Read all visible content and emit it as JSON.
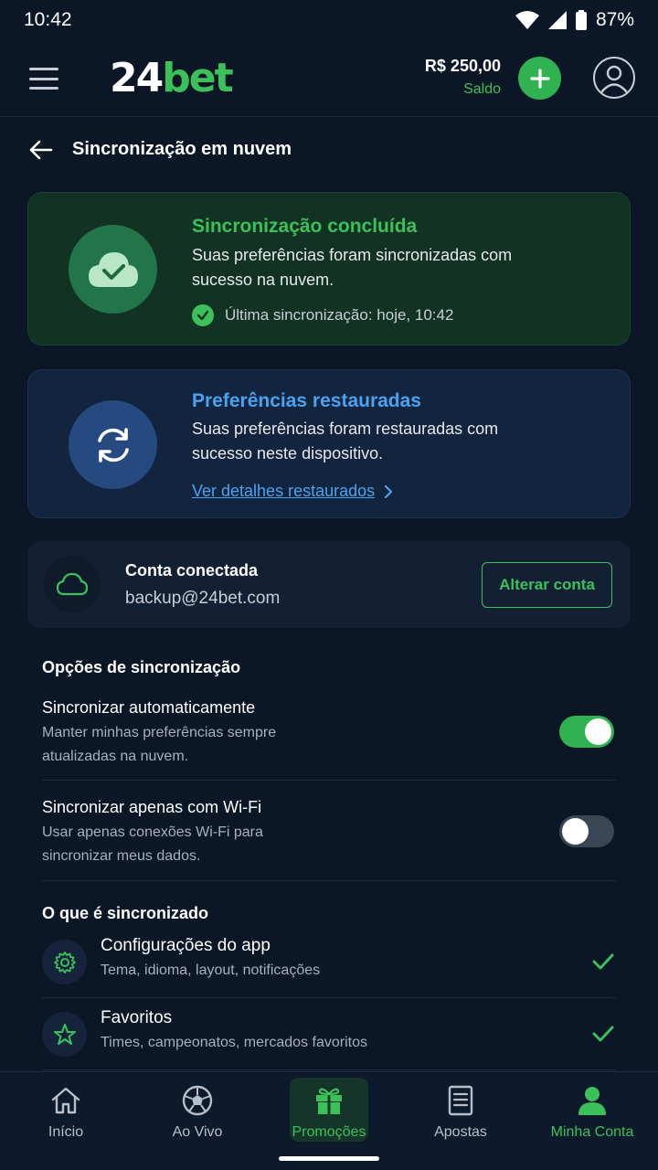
{
  "status_bar": {
    "time": "10:42",
    "battery": "87%"
  },
  "header": {
    "logo_number": "24",
    "logo_text": "bet",
    "balance_amount": "R$ 250,00",
    "balance_label": "Saldo"
  },
  "page": {
    "title": "Sincronização em nuvem"
  },
  "sync_card": {
    "title": "Sincronização concluída",
    "description": "Suas preferências foram sincronizadas com sucesso na nuvem.",
    "last_sync": "Última sincronização: hoje, 10:42"
  },
  "restore_card": {
    "title": "Preferências restauradas",
    "description": "Suas preferências foram restauradas com sucesso neste dispositivo.",
    "link": "Ver detalhes restaurados"
  },
  "account": {
    "title": "Conta conectada",
    "email": "backup@24bet.com",
    "change_button": "Alterar conta"
  },
  "sync_options": {
    "heading": "Opções de sincronização",
    "items": [
      {
        "title": "Sincronizar automaticamente",
        "description": "Manter minhas preferências sempre atualizadas na nuvem.",
        "enabled": true
      },
      {
        "title": "Sincronizar apenas com Wi-Fi",
        "description": "Usar apenas conexões Wi-Fi para sincronizar meus dados.",
        "enabled": false
      }
    ]
  },
  "synced_items": {
    "heading": "O que é sincronizado",
    "items": [
      {
        "title": "Configurações do app",
        "description": "Tema, idioma, layout, notificações",
        "icon": "gear-icon"
      },
      {
        "title": "Favoritos",
        "description": "Times, campeonatos, mercados favoritos",
        "icon": "star-icon"
      }
    ]
  },
  "bottom_nav": {
    "items": [
      {
        "label": "Início",
        "icon": "home-icon"
      },
      {
        "label": "Ao Vivo",
        "icon": "soccer-ball-icon"
      },
      {
        "label": "Promoções",
        "icon": "gift-icon"
      },
      {
        "label": "Apostas",
        "icon": "betslip-icon"
      },
      {
        "label": "Minha Conta",
        "icon": "user-icon"
      }
    ]
  },
  "colors": {
    "accent_green": "#3cc15a",
    "accent_blue": "#4aa3f0",
    "background": "#0b1626"
  }
}
